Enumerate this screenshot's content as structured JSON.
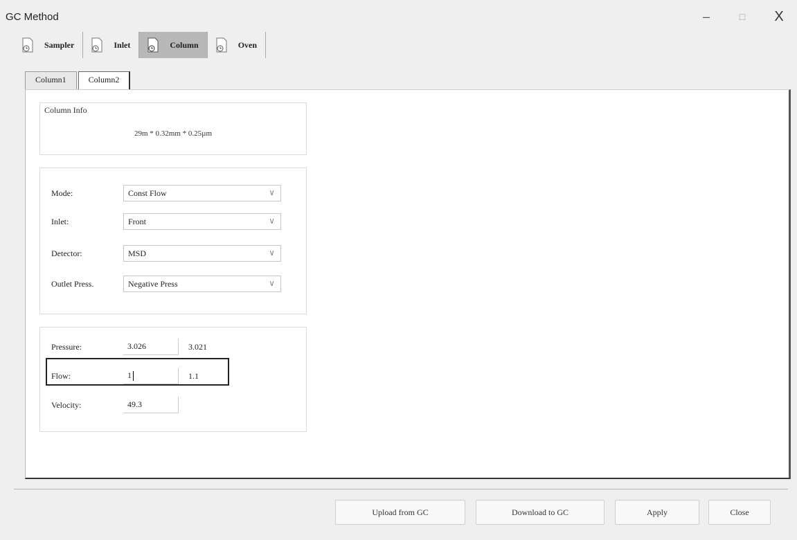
{
  "window": {
    "title": "GC Method",
    "minimize": "–",
    "maximize": "□",
    "close": "X"
  },
  "main_tabs": [
    {
      "label": "Sampler",
      "icon": "document-clock-icon"
    },
    {
      "label": "Inlet",
      "icon": "document-clock-icon"
    },
    {
      "label": "Column",
      "icon": "document-clock-icon",
      "active": true
    },
    {
      "label": "Oven",
      "icon": "document-clock-icon"
    }
  ],
  "sub_tabs": [
    {
      "label": "Column1"
    },
    {
      "label": "Column2",
      "active": true
    }
  ],
  "column_info": {
    "title": "Column Info",
    "dimensions": "29m * 0.32mm * 0.25µm"
  },
  "fields": {
    "mode": {
      "label": "Mode:",
      "value": "Const Flow"
    },
    "inlet": {
      "label": "Inlet:",
      "value": "Front"
    },
    "detector": {
      "label": "Detector:",
      "value": "MSD"
    },
    "outlet": {
      "label": "Outlet Press.",
      "value": "Negative Press"
    }
  },
  "params": {
    "pressure": {
      "label": "Pressure:",
      "value": "3.026",
      "actual": "3.021"
    },
    "flow": {
      "label": "Flow:",
      "value": "1",
      "actual": "1.1"
    },
    "velocity": {
      "label": "Velocity:",
      "value": "49.3"
    }
  },
  "buttons": {
    "upload": "Upload from GC",
    "download": "Download to GC",
    "apply": "Apply",
    "close": "Close"
  }
}
